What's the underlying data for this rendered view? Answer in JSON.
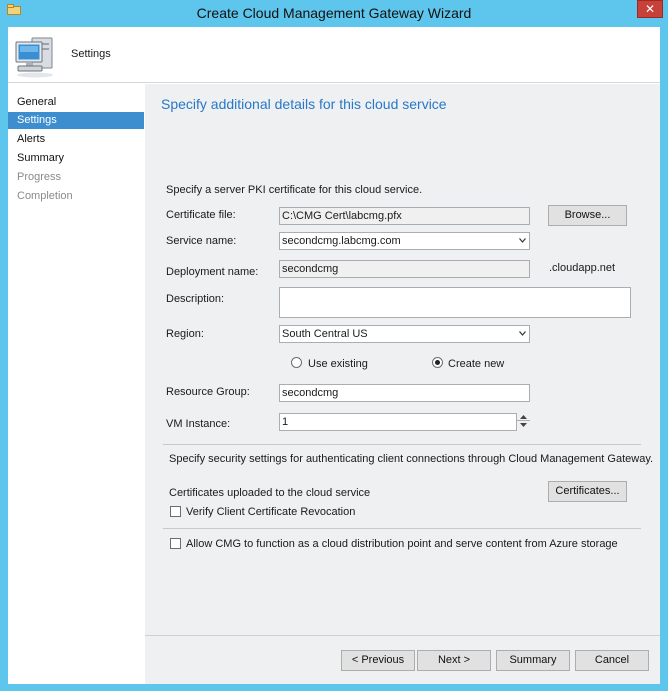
{
  "window": {
    "title": "Create Cloud Management Gateway Wizard",
    "close_glyph": "✕"
  },
  "header": {
    "title": "Settings",
    "icon": "computer-icon"
  },
  "nav": {
    "items": [
      {
        "label": "General",
        "state": "normal"
      },
      {
        "label": "Settings",
        "state": "active"
      },
      {
        "label": "Alerts",
        "state": "normal"
      },
      {
        "label": "Summary",
        "state": "normal"
      },
      {
        "label": "Progress",
        "state": "disabled"
      },
      {
        "label": "Completion",
        "state": "disabled"
      }
    ]
  },
  "page": {
    "title": "Specify additional details for this cloud service",
    "pki_intro": "Specify a server PKI certificate for this cloud service.",
    "certificate_file": {
      "label": "Certificate file:",
      "value": "C:\\CMG Cert\\labcmg.pfx"
    },
    "browse_label": "Browse...",
    "service_name": {
      "label": "Service name:",
      "value": "secondcmg.labcmg.com"
    },
    "deployment_name": {
      "label": "Deployment name:",
      "value": "secondcmg",
      "suffix": ".cloudapp.net"
    },
    "description": {
      "label": "Description:",
      "value": ""
    },
    "region": {
      "label": "Region:",
      "value": "South Central US"
    },
    "resource_group_options": {
      "use_existing": {
        "label": "Use existing",
        "selected": false
      },
      "create_new": {
        "label": "Create new",
        "selected": true
      }
    },
    "resource_group": {
      "label": "Resource Group:",
      "value": "secondcmg"
    },
    "vm_instance": {
      "label": "VM Instance:",
      "value": "1"
    },
    "security_intro": "Specify security settings for authenticating client connections through Cloud Management Gateway.",
    "certs_uploaded_label": "Certificates uploaded to the cloud service",
    "certificates_button": "Certificates...",
    "verify_revocation": {
      "label": "Verify Client Certificate Revocation",
      "checked": false
    },
    "allow_cdp": {
      "label": "Allow CMG to function as a cloud distribution point and serve content from Azure storage",
      "checked": false
    }
  },
  "footer": {
    "previous": "< Previous",
    "next": "Next >",
    "summary": "Summary",
    "cancel": "Cancel"
  },
  "colors": {
    "title_bar": "#5ec5ec",
    "accent": "#2878c8",
    "nav_active": "#3d8ecf",
    "close": "#c7413a"
  }
}
